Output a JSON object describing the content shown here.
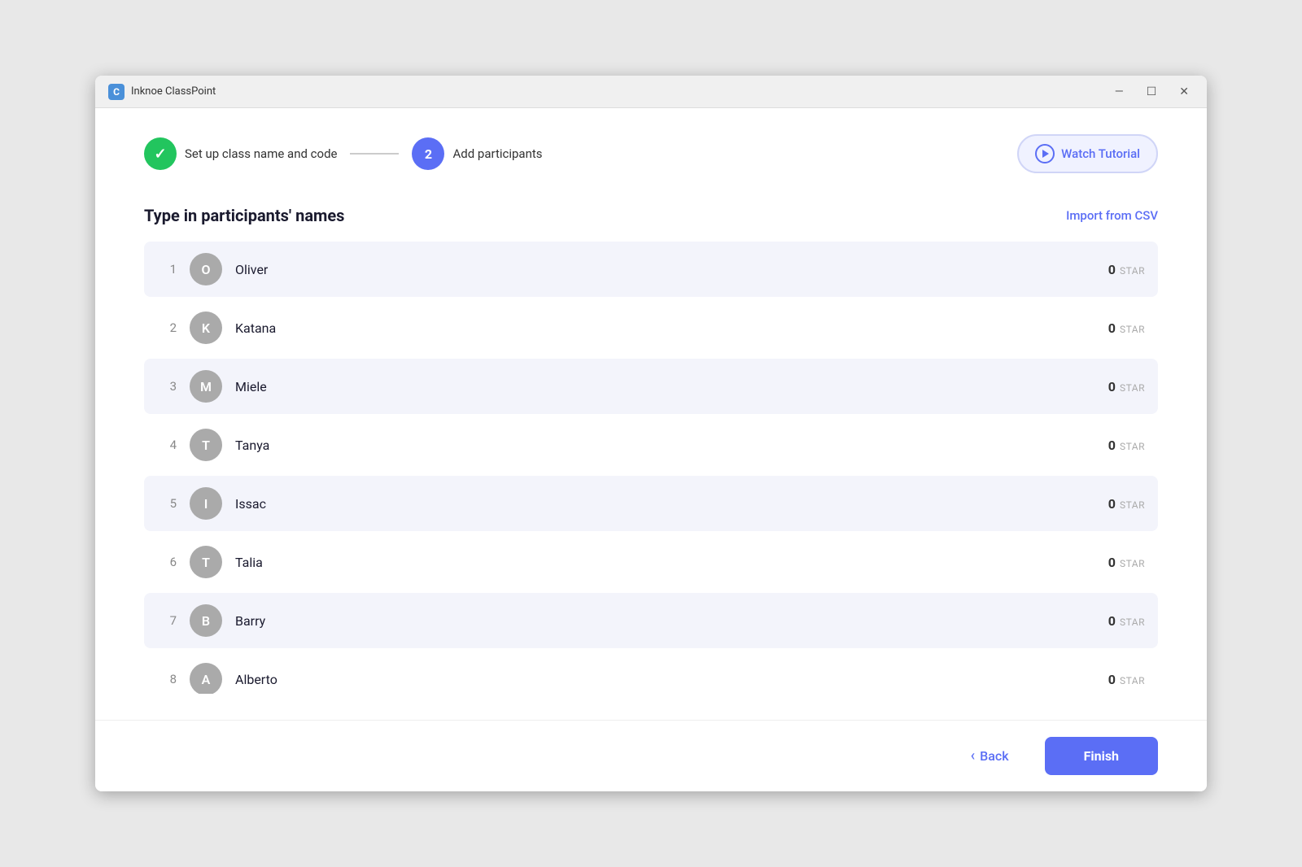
{
  "titleBar": {
    "appName": "Inknoe ClassPoint",
    "iconText": "C",
    "minimizeLabel": "—",
    "maximizeLabel": "☐",
    "closeLabel": "✕"
  },
  "stepper": {
    "step1": {
      "label": "Set up class name and code",
      "completed": true
    },
    "step2": {
      "number": "2",
      "label": "Add participants"
    },
    "watchTutorial": "Watch Tutorial"
  },
  "section": {
    "title": "Type in participants' names",
    "importCsvLabel": "Import from CSV"
  },
  "participants": [
    {
      "number": "1",
      "initial": "O",
      "name": "Oliver",
      "stars": "0"
    },
    {
      "number": "2",
      "initial": "K",
      "name": "Katana",
      "stars": "0"
    },
    {
      "number": "3",
      "initial": "M",
      "name": "Miele",
      "stars": "0"
    },
    {
      "number": "4",
      "initial": "T",
      "name": "Tanya",
      "stars": "0"
    },
    {
      "number": "5",
      "initial": "I",
      "name": "Issac",
      "stars": "0"
    },
    {
      "number": "6",
      "initial": "T",
      "name": "Talia",
      "stars": "0"
    },
    {
      "number": "7",
      "initial": "B",
      "name": "Barry",
      "stars": "0"
    },
    {
      "number": "8",
      "initial": "A",
      "name": "Alberto",
      "stars": "0"
    }
  ],
  "starLabel": "STAR",
  "footer": {
    "backLabel": "Back",
    "finishLabel": "Finish"
  }
}
